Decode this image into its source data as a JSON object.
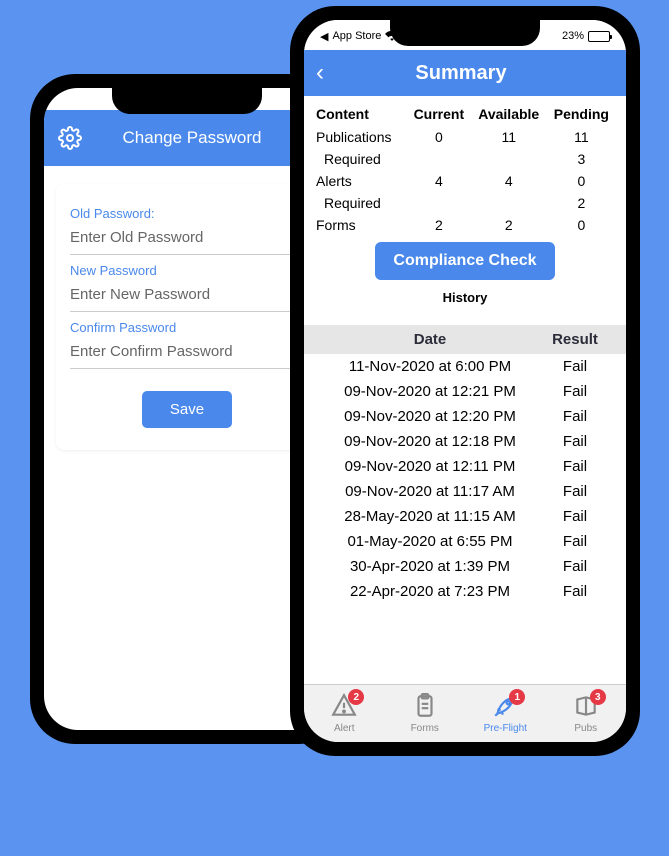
{
  "back_phone": {
    "header_title": "Change Password",
    "fields": {
      "old": {
        "label": "Old Password:",
        "placeholder": "Enter Old Password"
      },
      "new": {
        "label": "New Password",
        "placeholder": "Enter New Password"
      },
      "confirm": {
        "label": "Confirm Password",
        "placeholder": "Enter Confirm Password"
      }
    },
    "save_label": "Save"
  },
  "front_phone": {
    "status": {
      "left_text": "App Store",
      "battery_text": "23%"
    },
    "header_title": "Summary",
    "content_headers": {
      "c0": "Content",
      "c1": "Current",
      "c2": "Available",
      "c3": "Pending"
    },
    "rows": [
      {
        "name": "Publications",
        "current": "0",
        "available": "11",
        "pending": "11",
        "indent": false
      },
      {
        "name": "Required",
        "current": "",
        "available": "",
        "pending": "3",
        "indent": true
      },
      {
        "name": "Alerts",
        "current": "4",
        "available": "4",
        "pending": "0",
        "indent": false
      },
      {
        "name": "Required",
        "current": "",
        "available": "",
        "pending": "2",
        "indent": true
      },
      {
        "name": "Forms",
        "current": "2",
        "available": "2",
        "pending": "0",
        "indent": false
      }
    ],
    "compliance_label": "Compliance Check",
    "history_label": "History",
    "history_headers": {
      "date": "Date",
      "result": "Result"
    },
    "history": [
      {
        "date": "11-Nov-2020 at 6:00 PM",
        "result": "Fail"
      },
      {
        "date": "09-Nov-2020 at 12:21 PM",
        "result": "Fail"
      },
      {
        "date": "09-Nov-2020 at 12:20 PM",
        "result": "Fail"
      },
      {
        "date": "09-Nov-2020 at 12:18 PM",
        "result": "Fail"
      },
      {
        "date": "09-Nov-2020 at 12:11 PM",
        "result": "Fail"
      },
      {
        "date": "09-Nov-2020 at 11:17 AM",
        "result": "Fail"
      },
      {
        "date": "28-May-2020 at 11:15 AM",
        "result": "Fail"
      },
      {
        "date": "01-May-2020 at 6:55 PM",
        "result": "Fail"
      },
      {
        "date": "30-Apr-2020 at 1:39 PM",
        "result": "Fail"
      },
      {
        "date": "22-Apr-2020 at 7:23 PM",
        "result": "Fail"
      }
    ],
    "tabs": [
      {
        "label": "Alert",
        "badge": "2",
        "active": false
      },
      {
        "label": "Forms",
        "badge": "",
        "active": false
      },
      {
        "label": "Pre-Flight",
        "badge": "1",
        "active": true
      },
      {
        "label": "Pubs",
        "badge": "3",
        "active": false
      }
    ]
  }
}
